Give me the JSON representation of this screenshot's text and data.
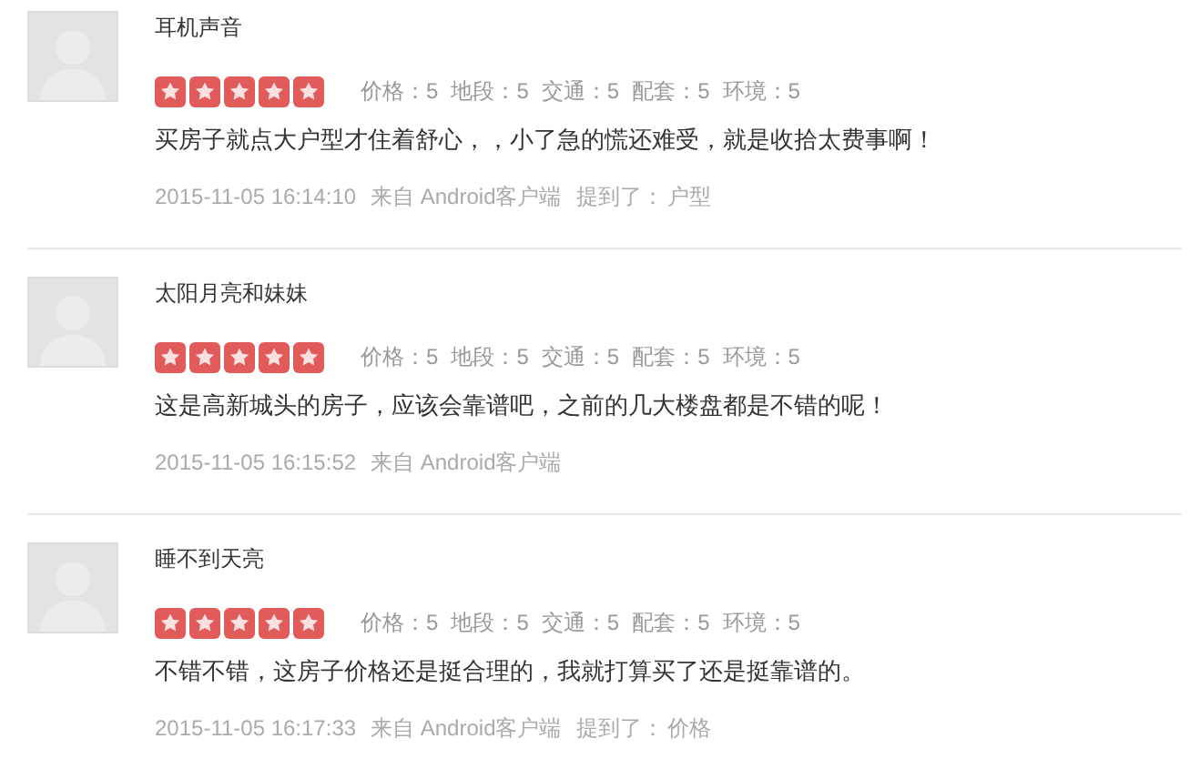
{
  "reviews": [
    {
      "author": "耳机声音",
      "stars": 5,
      "scores": [
        "价格：5",
        "地段：5",
        "交通：5",
        "配套：5",
        "环境：5"
      ],
      "comment": "买房子就点大户型才住着舒心，，小了急的慌还难受，就是收拾太费事啊！",
      "time": "2015-11-05 16:14:10",
      "source": "来自 Android客户端",
      "mention_label": "提到了：",
      "mention": "户型"
    },
    {
      "author": "太阳月亮和妹妹",
      "stars": 5,
      "scores": [
        "价格：5",
        "地段：5",
        "交通：5",
        "配套：5",
        "环境：5"
      ],
      "comment": "这是高新城头的房子，应该会靠谱吧，之前的几大楼盘都是不错的呢！",
      "time": "2015-11-05 16:15:52",
      "source": "来自 Android客户端"
    },
    {
      "author": "睡不到天亮",
      "stars": 5,
      "scores": [
        "价格：5",
        "地段：5",
        "交通：5",
        "配套：5",
        "环境：5"
      ],
      "comment": "不错不错，这房子价格还是挺合理的，我就打算买了还是挺靠谱的。",
      "time": "2015-11-05 16:17:33",
      "source": "来自 Android客户端",
      "mention_label": "提到了：",
      "mention": "价格"
    }
  ]
}
